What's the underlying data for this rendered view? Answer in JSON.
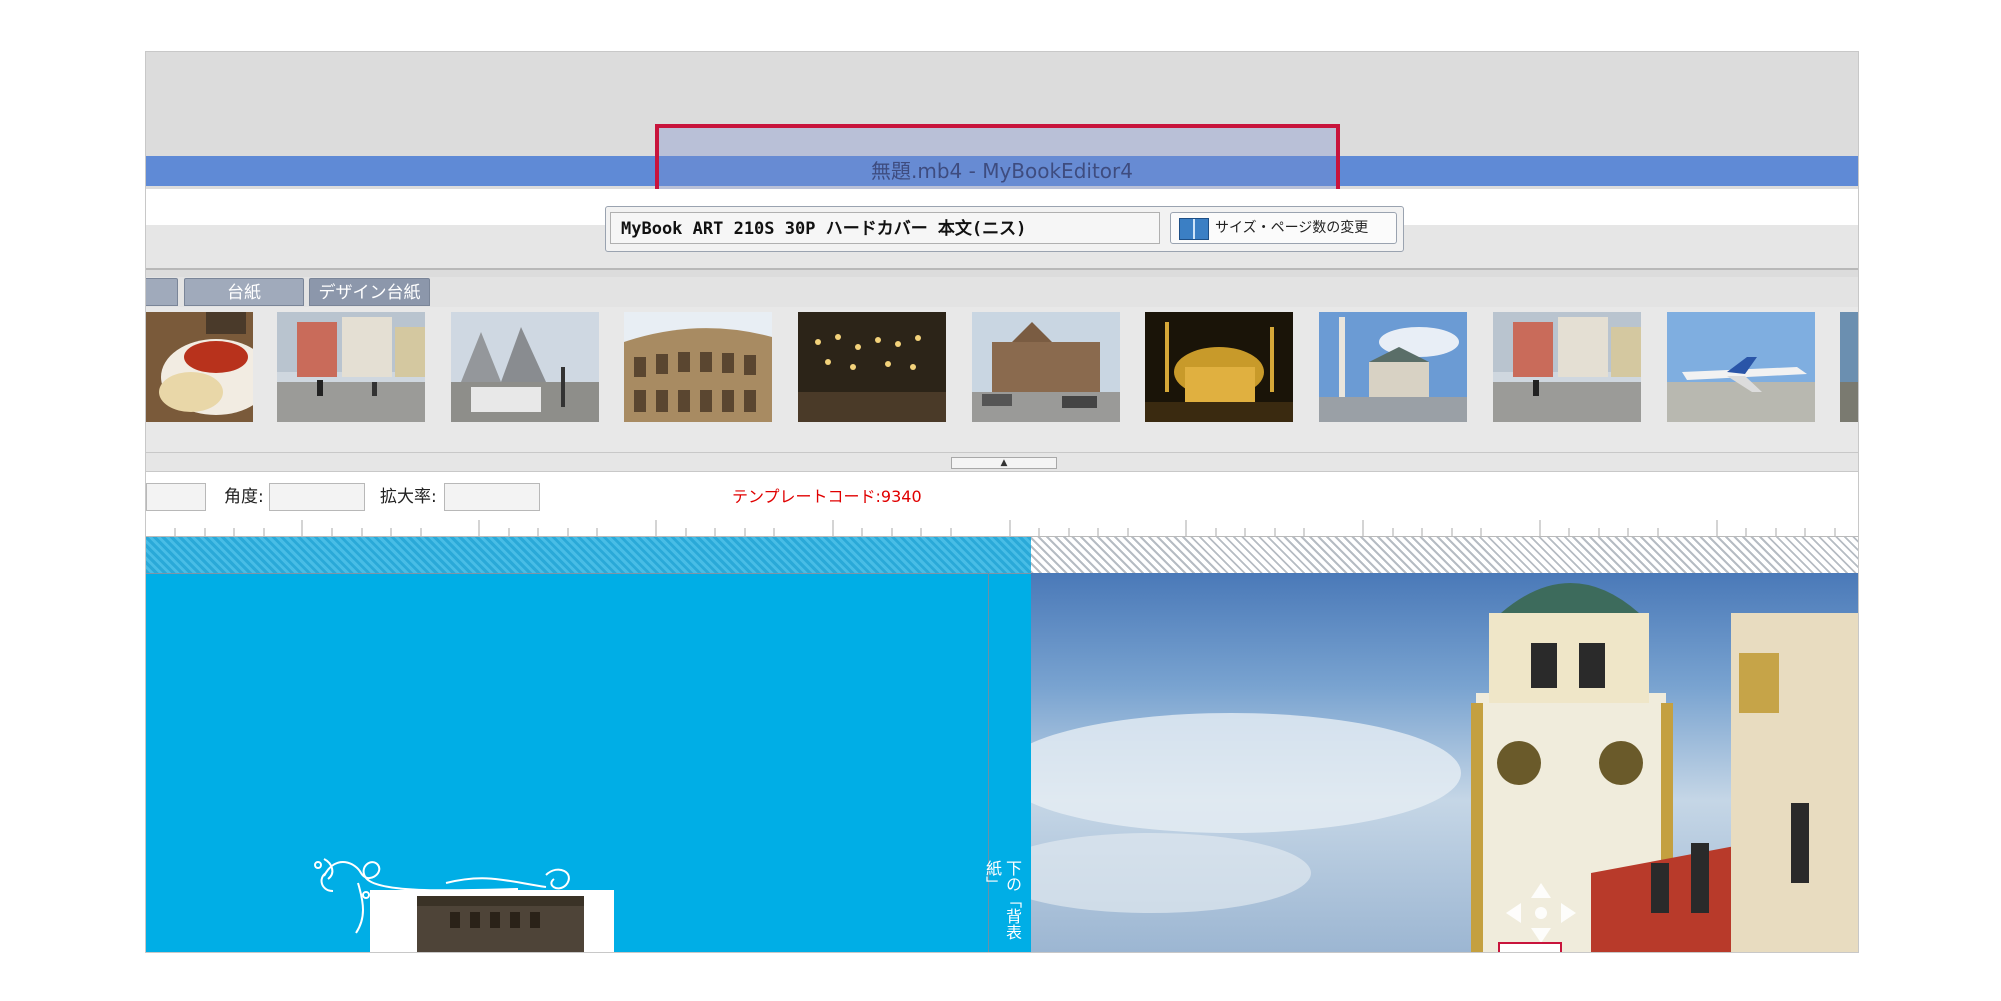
{
  "window": {
    "title": "無題.mb4 - MyBookEditor4"
  },
  "toolbar": {
    "product_select": "MyBook ART 210S 30P ハードカバー 本文(ニス)",
    "size_button_label": "サイズ・ページ数の変更"
  },
  "tabs": [
    {
      "label": ""
    },
    {
      "label": "台紙"
    },
    {
      "label": "デザイン台紙"
    }
  ],
  "thumbnails": [
    {
      "subject": "food plate"
    },
    {
      "subject": "street buildings"
    },
    {
      "subject": "bare trees street"
    },
    {
      "subject": "colosseum"
    },
    {
      "subject": "mosque interior lamps"
    },
    {
      "subject": "old brick building"
    },
    {
      "subject": "mosque at night"
    },
    {
      "subject": "minaret fountain"
    },
    {
      "subject": "street buildings"
    },
    {
      "subject": "airplane on tarmac"
    },
    {
      "subject": "partial"
    }
  ],
  "properties": {
    "angle_label": "角度:",
    "zoom_label": "拡大率:",
    "template_code": "テンプレートコード:9340",
    "angle_value": "",
    "zoom_value": ""
  },
  "canvas": {
    "spine_text": "下の「背表紙」",
    "left_page_color": "#00aee6"
  },
  "colors": {
    "titlebar": "#5f8ad6",
    "highlight": "#c8143c",
    "template_code": "#e00000"
  }
}
